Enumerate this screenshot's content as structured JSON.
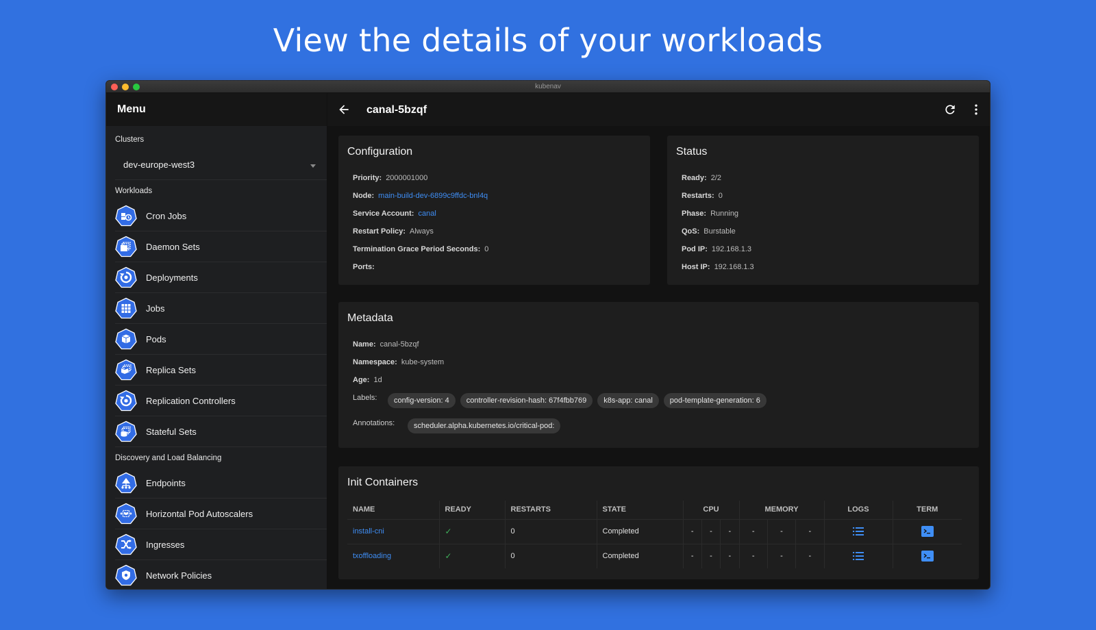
{
  "headline": "View the details of your workloads",
  "window": {
    "title": "kubenav"
  },
  "sidebar": {
    "menu_title": "Menu",
    "clusters_label": "Clusters",
    "selected_cluster": "dev-europe-west3",
    "workloads_label": "Workloads",
    "workloads": [
      {
        "label": "Cron Jobs",
        "icon": "cronjob-icon"
      },
      {
        "label": "Daemon Sets",
        "icon": "daemonset-icon"
      },
      {
        "label": "Deployments",
        "icon": "deployment-icon"
      },
      {
        "label": "Jobs",
        "icon": "job-icon"
      },
      {
        "label": "Pods",
        "icon": "pod-icon"
      },
      {
        "label": "Replica Sets",
        "icon": "replicaset-icon"
      },
      {
        "label": "Replication Controllers",
        "icon": "replicationcontroller-icon"
      },
      {
        "label": "Stateful Sets",
        "icon": "statefulset-icon"
      }
    ],
    "discovery_label": "Discovery and Load Balancing",
    "discovery": [
      {
        "label": "Endpoints",
        "icon": "endpoints-icon"
      },
      {
        "label": "Horizontal Pod Autoscalers",
        "icon": "hpa-icon"
      },
      {
        "label": "Ingresses",
        "icon": "ingress-icon"
      },
      {
        "label": "Network Policies",
        "icon": "networkpolicy-icon"
      }
    ]
  },
  "toolbar": {
    "title": "canal-5bzqf"
  },
  "configuration": {
    "title": "Configuration",
    "priority_key": "Priority:",
    "priority": "2000001000",
    "node_key": "Node:",
    "node": "main-build-dev-6899c9ffdc-bnl4q",
    "service_account_key": "Service Account:",
    "service_account": "canal",
    "restart_policy_key": "Restart Policy:",
    "restart_policy": "Always",
    "termination_key": "Termination Grace Period Seconds:",
    "termination": "0",
    "ports_key": "Ports:"
  },
  "status": {
    "title": "Status",
    "ready_key": "Ready:",
    "ready": "2/2",
    "restarts_key": "Restarts:",
    "restarts": "0",
    "phase_key": "Phase:",
    "phase": "Running",
    "qos_key": "QoS:",
    "qos": "Burstable",
    "pod_ip_key": "Pod IP:",
    "pod_ip": "192.168.1.3",
    "host_ip_key": "Host IP:",
    "host_ip": "192.168.1.3"
  },
  "metadata": {
    "title": "Metadata",
    "name_key": "Name:",
    "name": "canal-5bzqf",
    "namespace_key": "Namespace:",
    "namespace": "kube-system",
    "age_key": "Age:",
    "age": "1d",
    "labels_key": "Labels:",
    "labels": [
      "config-version: 4",
      "controller-revision-hash: 67f4fbb769",
      "k8s-app: canal",
      "pod-template-generation: 6"
    ],
    "annotations_key": "Annotations:",
    "annotations": [
      "scheduler.alpha.kubernetes.io/critical-pod:"
    ]
  },
  "init_containers": {
    "title": "Init Containers",
    "headers": {
      "name": "NAME",
      "ready": "READY",
      "restarts": "RESTARTS",
      "state": "STATE",
      "cpu": "CPU",
      "memory": "MEMORY",
      "logs": "LOGS",
      "term": "TERM"
    },
    "rows": [
      {
        "name": "install-cni",
        "ready": "✓",
        "restarts": "0",
        "state": "Completed",
        "cpu": [
          "-",
          "-",
          "-"
        ],
        "memory": [
          "-",
          "-",
          "-"
        ]
      },
      {
        "name": "txoffloading",
        "ready": "✓",
        "restarts": "0",
        "state": "Completed",
        "cpu": [
          "-",
          "-",
          "-"
        ],
        "memory": [
          "-",
          "-",
          "-"
        ]
      }
    ]
  },
  "colors": {
    "background": "#3171e0",
    "accent": "#3f8ef5",
    "icon_blue": "#326ce5",
    "check_green": "#3fae5a"
  }
}
